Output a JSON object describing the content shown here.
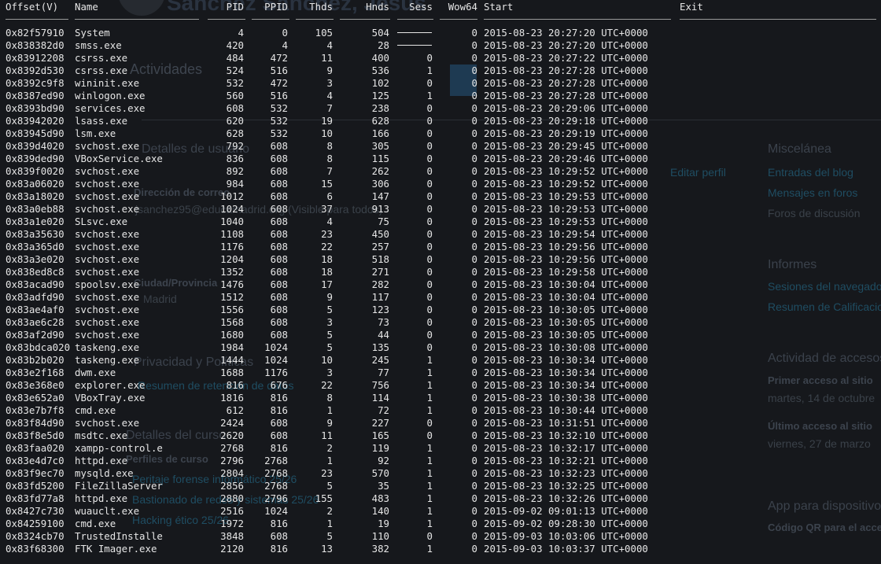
{
  "background": {
    "title": "Sánchez Sánchez, Jesús",
    "sections": {
      "actividades": "Actividades",
      "detalles_usuario": "Detalles de usuario",
      "direccion_correo": "Dirección de correo",
      "email": "jsanchez95@educamadrid.org (Visible para todos)",
      "ciudad_label": "Ciudad/Provincia",
      "ciudad": "Madrid",
      "privacidad": "Privacidad y Políticas",
      "retencion": "Resumen de retención de datos",
      "detalles_curso": "Detalles del curso",
      "perfiles_curso": "Perfiles de curso",
      "curso1": "Peritaje forense informático 25/26",
      "curso2": "Bastionado de redes y sistemas 25/26",
      "curso3": "Hacking ético 25/26",
      "editar_perfil": "Editar perfil"
    },
    "right": {
      "miscelanea": "Miscelánea",
      "entradas_blog": "Entradas del blog",
      "mensajes_foros": "Mensajes en foros",
      "foros_discusion": "Foros de discusión",
      "informes": "Informes",
      "sesiones": "Sesiones del navegador",
      "resumen_calif": "Resumen de Calificaciones",
      "actividad_accesos": "Actividad de accesos",
      "primer_acceso": "Primer acceso al sitio",
      "primer_fecha": "martes, 14 de octubre",
      "ultimo_acceso": "Último acceso al sitio",
      "ultimo_fecha": "viernes, 27 de marzo",
      "app": "App para dispositivos",
      "codigo_qr": "Código QR para el acceso"
    }
  },
  "columns": [
    "Offset(V)",
    "Name",
    "PID",
    "PPID",
    "Thds",
    "Hnds",
    "Sess",
    "Wow64",
    "Start",
    "Exit"
  ],
  "processes": [
    {
      "offset": "0x82f57910",
      "name": "System",
      "pid": "4",
      "ppid": "0",
      "thds": "105",
      "hnds": "504",
      "sess": "-",
      "wow64": "0",
      "start": "2015-08-23 20:27:20 UTC+0000",
      "exit": ""
    },
    {
      "offset": "0x838382d0",
      "name": "smss.exe",
      "pid": "420",
      "ppid": "4",
      "thds": "4",
      "hnds": "28",
      "sess": "-",
      "wow64": "0",
      "start": "2015-08-23 20:27:20 UTC+0000",
      "exit": ""
    },
    {
      "offset": "0x83912208",
      "name": "csrss.exe",
      "pid": "484",
      "ppid": "472",
      "thds": "11",
      "hnds": "400",
      "sess": "0",
      "wow64": "0",
      "start": "2015-08-23 20:27:22 UTC+0000",
      "exit": ""
    },
    {
      "offset": "0x8392d530",
      "name": "csrss.exe",
      "pid": "524",
      "ppid": "516",
      "thds": "9",
      "hnds": "536",
      "sess": "1",
      "wow64": "0",
      "start": "2015-08-23 20:27:28 UTC+0000",
      "exit": ""
    },
    {
      "offset": "0x8392c9f8",
      "name": "wininit.exe",
      "pid": "532",
      "ppid": "472",
      "thds": "3",
      "hnds": "102",
      "sess": "0",
      "wow64": "0",
      "start": "2015-08-23 20:27:28 UTC+0000",
      "exit": ""
    },
    {
      "offset": "0x8387ed90",
      "name": "winlogon.exe",
      "pid": "560",
      "ppid": "516",
      "thds": "4",
      "hnds": "125",
      "sess": "1",
      "wow64": "0",
      "start": "2015-08-23 20:27:28 UTC+0000",
      "exit": ""
    },
    {
      "offset": "0x8393bd90",
      "name": "services.exe",
      "pid": "608",
      "ppid": "532",
      "thds": "7",
      "hnds": "238",
      "sess": "0",
      "wow64": "0",
      "start": "2015-08-23 20:29:06 UTC+0000",
      "exit": ""
    },
    {
      "offset": "0x83942020",
      "name": "lsass.exe",
      "pid": "620",
      "ppid": "532",
      "thds": "19",
      "hnds": "628",
      "sess": "0",
      "wow64": "0",
      "start": "2015-08-23 20:29:18 UTC+0000",
      "exit": ""
    },
    {
      "offset": "0x83945d90",
      "name": "lsm.exe",
      "pid": "628",
      "ppid": "532",
      "thds": "10",
      "hnds": "166",
      "sess": "0",
      "wow64": "0",
      "start": "2015-08-23 20:29:19 UTC+0000",
      "exit": ""
    },
    {
      "offset": "0x839d4020",
      "name": "svchost.exe",
      "pid": "792",
      "ppid": "608",
      "thds": "8",
      "hnds": "305",
      "sess": "0",
      "wow64": "0",
      "start": "2015-08-23 20:29:45 UTC+0000",
      "exit": ""
    },
    {
      "offset": "0x839ded90",
      "name": "VBoxService.exe",
      "pid": "836",
      "ppid": "608",
      "thds": "8",
      "hnds": "115",
      "sess": "0",
      "wow64": "0",
      "start": "2015-08-23 20:29:46 UTC+0000",
      "exit": ""
    },
    {
      "offset": "0x839f0020",
      "name": "svchost.exe",
      "pid": "892",
      "ppid": "608",
      "thds": "7",
      "hnds": "262",
      "sess": "0",
      "wow64": "0",
      "start": "2015-08-23 10:29:52 UTC+0000",
      "exit": ""
    },
    {
      "offset": "0x83a06020",
      "name": "svchost.exe",
      "pid": "984",
      "ppid": "608",
      "thds": "15",
      "hnds": "306",
      "sess": "0",
      "wow64": "0",
      "start": "2015-08-23 10:29:52 UTC+0000",
      "exit": ""
    },
    {
      "offset": "0x83a18020",
      "name": "svchost.exe",
      "pid": "1012",
      "ppid": "608",
      "thds": "6",
      "hnds": "147",
      "sess": "0",
      "wow64": "0",
      "start": "2015-08-23 10:29:53 UTC+0000",
      "exit": ""
    },
    {
      "offset": "0x83a0eb88",
      "name": "svchost.exe",
      "pid": "1024",
      "ppid": "608",
      "thds": "37",
      "hnds": "913",
      "sess": "0",
      "wow64": "0",
      "start": "2015-08-23 10:29:53 UTC+0000",
      "exit": ""
    },
    {
      "offset": "0x83a1e020",
      "name": "SLsvc.exe",
      "pid": "1040",
      "ppid": "608",
      "thds": "4",
      "hnds": "75",
      "sess": "0",
      "wow64": "0",
      "start": "2015-08-23 10:29:53 UTC+0000",
      "exit": ""
    },
    {
      "offset": "0x83a35630",
      "name": "svchost.exe",
      "pid": "1108",
      "ppid": "608",
      "thds": "23",
      "hnds": "450",
      "sess": "0",
      "wow64": "0",
      "start": "2015-08-23 10:29:54 UTC+0000",
      "exit": ""
    },
    {
      "offset": "0x83a365d0",
      "name": "svchost.exe",
      "pid": "1176",
      "ppid": "608",
      "thds": "22",
      "hnds": "257",
      "sess": "0",
      "wow64": "0",
      "start": "2015-08-23 10:29:56 UTC+0000",
      "exit": ""
    },
    {
      "offset": "0x83a3e020",
      "name": "svchost.exe",
      "pid": "1204",
      "ppid": "608",
      "thds": "18",
      "hnds": "518",
      "sess": "0",
      "wow64": "0",
      "start": "2015-08-23 10:29:56 UTC+0000",
      "exit": ""
    },
    {
      "offset": "0x838ed8c8",
      "name": "svchost.exe",
      "pid": "1352",
      "ppid": "608",
      "thds": "18",
      "hnds": "271",
      "sess": "0",
      "wow64": "0",
      "start": "2015-08-23 10:29:58 UTC+0000",
      "exit": ""
    },
    {
      "offset": "0x83acad90",
      "name": "spoolsv.exe",
      "pid": "1476",
      "ppid": "608",
      "thds": "17",
      "hnds": "282",
      "sess": "0",
      "wow64": "0",
      "start": "2015-08-23 10:30:04 UTC+0000",
      "exit": ""
    },
    {
      "offset": "0x83adfd90",
      "name": "svchost.exe",
      "pid": "1512",
      "ppid": "608",
      "thds": "9",
      "hnds": "117",
      "sess": "0",
      "wow64": "0",
      "start": "2015-08-23 10:30:04 UTC+0000",
      "exit": ""
    },
    {
      "offset": "0x83ae4af0",
      "name": "svchost.exe",
      "pid": "1556",
      "ppid": "608",
      "thds": "5",
      "hnds": "123",
      "sess": "0",
      "wow64": "0",
      "start": "2015-08-23 10:30:05 UTC+0000",
      "exit": ""
    },
    {
      "offset": "0x83ae6c28",
      "name": "svchost.exe",
      "pid": "1568",
      "ppid": "608",
      "thds": "3",
      "hnds": "73",
      "sess": "0",
      "wow64": "0",
      "start": "2015-08-23 10:30:05 UTC+0000",
      "exit": ""
    },
    {
      "offset": "0x83af2d90",
      "name": "svchost.exe",
      "pid": "1680",
      "ppid": "608",
      "thds": "5",
      "hnds": "44",
      "sess": "0",
      "wow64": "0",
      "start": "2015-08-23 10:30:05 UTC+0000",
      "exit": ""
    },
    {
      "offset": "0x83bdca020",
      "name": "taskeng.exe",
      "pid": "1984",
      "ppid": "1024",
      "thds": "5",
      "hnds": "135",
      "sess": "0",
      "wow64": "0",
      "start": "2015-08-23 10:30:08 UTC+0000",
      "exit": ""
    },
    {
      "offset": "0x83b2b020",
      "name": "taskeng.exe",
      "pid": "1444",
      "ppid": "1024",
      "thds": "10",
      "hnds": "245",
      "sess": "1",
      "wow64": "0",
      "start": "2015-08-23 10:30:34 UTC+0000",
      "exit": ""
    },
    {
      "offset": "0x83e2f168",
      "name": "dwm.exe",
      "pid": "1688",
      "ppid": "1176",
      "thds": "3",
      "hnds": "77",
      "sess": "1",
      "wow64": "0",
      "start": "2015-08-23 10:30:34 UTC+0000",
      "exit": ""
    },
    {
      "offset": "0x83e368e0",
      "name": "explorer.exe",
      "pid": "816",
      "ppid": "676",
      "thds": "22",
      "hnds": "756",
      "sess": "1",
      "wow64": "0",
      "start": "2015-08-23 10:30:34 UTC+0000",
      "exit": ""
    },
    {
      "offset": "0x83e652a0",
      "name": "VBoxTray.exe",
      "pid": "1816",
      "ppid": "816",
      "thds": "8",
      "hnds": "114",
      "sess": "1",
      "wow64": "0",
      "start": "2015-08-23 10:30:38 UTC+0000",
      "exit": ""
    },
    {
      "offset": "0x83e7b7f8",
      "name": "cmd.exe",
      "pid": "612",
      "ppid": "816",
      "thds": "1",
      "hnds": "72",
      "sess": "1",
      "wow64": "0",
      "start": "2015-08-23 10:30:44 UTC+0000",
      "exit": ""
    },
    {
      "offset": "0x83f84d90",
      "name": "svchost.exe",
      "pid": "2424",
      "ppid": "608",
      "thds": "9",
      "hnds": "227",
      "sess": "0",
      "wow64": "0",
      "start": "2015-08-23 10:31:51 UTC+0000",
      "exit": ""
    },
    {
      "offset": "0x83f8e5d0",
      "name": "msdtc.exe",
      "pid": "2620",
      "ppid": "608",
      "thds": "11",
      "hnds": "165",
      "sess": "0",
      "wow64": "0",
      "start": "2015-08-23 10:32:10 UTC+0000",
      "exit": ""
    },
    {
      "offset": "0x83faa020",
      "name": "xampp-control.e",
      "pid": "2768",
      "ppid": "816",
      "thds": "2",
      "hnds": "119",
      "sess": "1",
      "wow64": "0",
      "start": "2015-08-23 10:32:17 UTC+0000",
      "exit": ""
    },
    {
      "offset": "0x83e4d7c0",
      "name": "httpd.exe",
      "pid": "2796",
      "ppid": "2768",
      "thds": "1",
      "hnds": "92",
      "sess": "1",
      "wow64": "0",
      "start": "2015-08-23 10:32:21 UTC+0000",
      "exit": ""
    },
    {
      "offset": "0x83f9ec70",
      "name": "mysqld.exe",
      "pid": "2804",
      "ppid": "2768",
      "thds": "23",
      "hnds": "570",
      "sess": "1",
      "wow64": "0",
      "start": "2015-08-23 10:32:23 UTC+0000",
      "exit": ""
    },
    {
      "offset": "0x83fd5200",
      "name": "FileZillaServer",
      "pid": "2856",
      "ppid": "2768",
      "thds": "5",
      "hnds": "35",
      "sess": "1",
      "wow64": "0",
      "start": "2015-08-23 10:32:25 UTC+0000",
      "exit": ""
    },
    {
      "offset": "0x83fd77a8",
      "name": "httpd.exe",
      "pid": "2880",
      "ppid": "2796",
      "thds": "155",
      "hnds": "483",
      "sess": "1",
      "wow64": "0",
      "start": "2015-08-23 10:32:26 UTC+0000",
      "exit": ""
    },
    {
      "offset": "0x8427c730",
      "name": "wuauclt.exe",
      "pid": "2516",
      "ppid": "1024",
      "thds": "2",
      "hnds": "140",
      "sess": "1",
      "wow64": "0",
      "start": "2015-09-02 09:01:13 UTC+0000",
      "exit": ""
    },
    {
      "offset": "0x84259100",
      "name": "cmd.exe",
      "pid": "1972",
      "ppid": "816",
      "thds": "1",
      "hnds": "19",
      "sess": "1",
      "wow64": "0",
      "start": "2015-09-02 09:28:30 UTC+0000",
      "exit": ""
    },
    {
      "offset": "0x8324cb70",
      "name": "TrustedInstalle",
      "pid": "3848",
      "ppid": "608",
      "thds": "5",
      "hnds": "110",
      "sess": "0",
      "wow64": "0",
      "start": "2015-09-03 10:03:06 UTC+0000",
      "exit": ""
    },
    {
      "offset": "0x83f68300",
      "name": "FTK Imager.exe",
      "pid": "2120",
      "ppid": "816",
      "thds": "13",
      "hnds": "382",
      "sess": "1",
      "wow64": "0",
      "start": "2015-09-03 10:03:37 UTC+0000",
      "exit": ""
    }
  ]
}
